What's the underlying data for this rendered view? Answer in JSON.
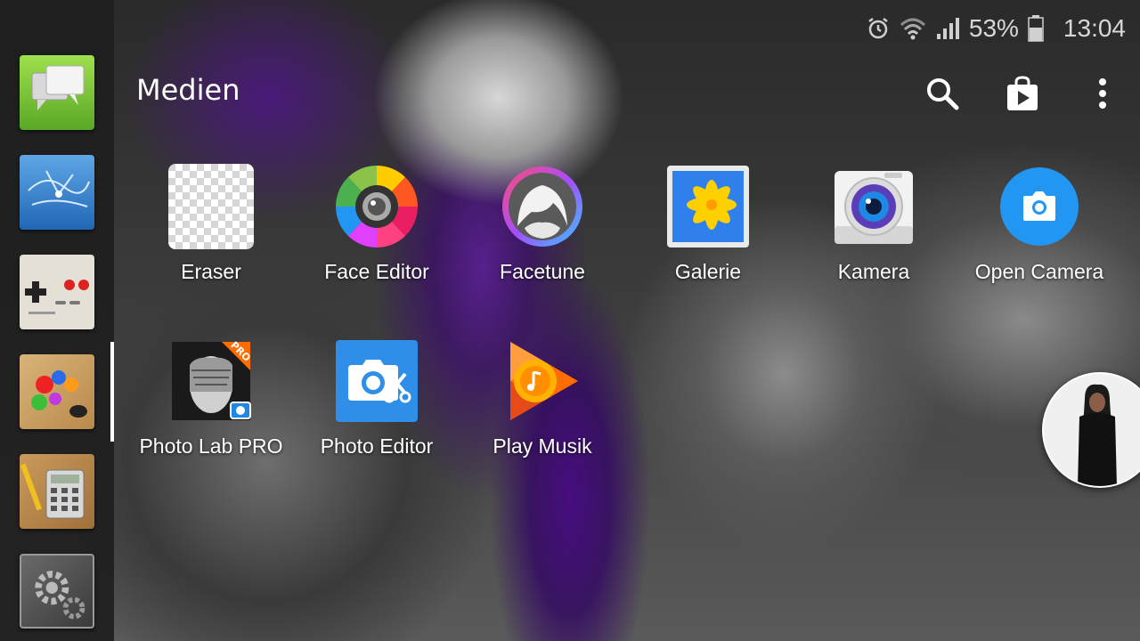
{
  "statusbar": {
    "battery_percent": "53%",
    "time": "13:04",
    "icons": [
      "alarm-icon",
      "wifi-icon",
      "signal-icon",
      "battery-icon"
    ]
  },
  "header": {
    "title": "Medien",
    "actions": [
      "search-icon",
      "play-store-icon",
      "more-vert-icon"
    ]
  },
  "dock": {
    "items": [
      "messages-icon",
      "browser-globe-icon",
      "game-emulator-icon",
      "paint-icon",
      "calculator-icon",
      "settings-gear-icon"
    ],
    "active_index": 3
  },
  "apps": [
    {
      "label": "Eraser",
      "icon": "eraser-icon"
    },
    {
      "label": "Face Editor",
      "icon": "face-editor-icon"
    },
    {
      "label": "Facetune",
      "icon": "facetune-icon"
    },
    {
      "label": "Galerie",
      "icon": "gallery-icon"
    },
    {
      "label": "Kamera",
      "icon": "camera-icon"
    },
    {
      "label": "Open Camera",
      "icon": "open-camera-icon"
    },
    {
      "label": "Photo Lab PRO",
      "icon": "photo-lab-icon"
    },
    {
      "label": "Photo Editor",
      "icon": "photo-editor-icon"
    },
    {
      "label": "Play Musik",
      "icon": "play-music-icon"
    }
  ],
  "badges": {
    "photo_lab": "PRO"
  },
  "colors": {
    "dock_bg": "#1e1e1e",
    "open_camera_blue": "#2196f3",
    "photo_editor_blue": "#2e8ee8",
    "play_music_orange": "#ff6d00",
    "gallery_yellow": "#ffd000"
  }
}
